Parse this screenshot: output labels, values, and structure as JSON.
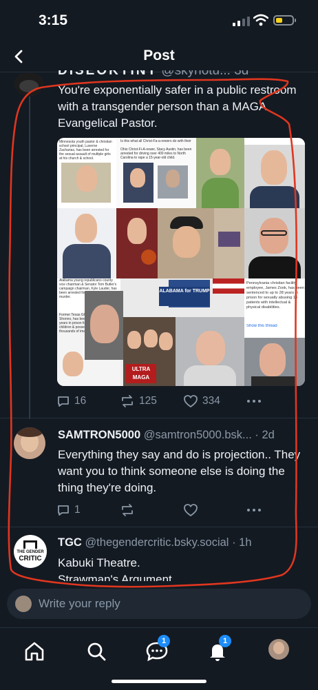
{
  "status": {
    "time": "3:15"
  },
  "header": {
    "title": "Post"
  },
  "main_post": {
    "display_name_partial": "DISEOKTINT",
    "handle_partial": "@skyhotu...",
    "time_partial": "3d",
    "text": "You're exponentially safer in a public restroom with a transgender person than a MAGA Evangelical Pastor.",
    "image": {
      "captions": [
        "Minnesota youth pastor & christian school principal, Luverne Zacharias, has been arrested for the sexual assault of multiple girls at his church & school.",
        "Is this what all Christ-Fa-a-rewers do with their Sundays?",
        "Ohio Christ-Fi-A-rewer, Stacy Austin, has been arrested for driving over 400 miles to North Carolina to rape a 15-year-old child.",
        "Alabama young republicans county vice chairman & Senator Tom Butler's campaign chairman, Kyle Lauder, has been arrested for sexual torture & murder.",
        "Former Texas GOP leader, Bo Shonno, has been sentenced to 40 years in prison for raping multiple children & possessing hundreds of thousands of images of children being sexually abused.",
        "Pennsylvania christian facility employee, James Zook, has been sentenced to up to 28 years in prison for sexually abusing 14 patients with intellectual & physical disabilities.",
        "Show this thread"
      ],
      "badges": [
        "ALABAMA for TRUMP",
        "ULTRA MAGA"
      ]
    },
    "stats": {
      "replies": "16",
      "reposts": "125",
      "likes": "334"
    }
  },
  "reply1": {
    "display_name": "SAMTRON5000",
    "handle": "@samtron5000.bsk...",
    "time": "· 2d",
    "text": "Everything they say and do is projection.. They want you to think someone else is doing the thing they're doing.",
    "stats": {
      "replies": "1"
    }
  },
  "reply2": {
    "display_name": "TGC",
    "handle": "@thegendercritic.bsky.social",
    "time": "· 1h",
    "avatar_text": [
      "THE GENDER",
      "CRITIC"
    ],
    "text_line1": "Kabuki Theatre.",
    "text_line2": "Strawman's Argument."
  },
  "composer": {
    "placeholder": "Write your reply"
  },
  "tabbar": {
    "chat_badge": "1",
    "notif_badge": "1"
  },
  "colors": {
    "background": "#141a22",
    "accent": "#1d8cf8",
    "annotation": "#e0361f",
    "muted": "#8b98a7"
  },
  "icons": [
    "back-arrow-icon",
    "reply-icon",
    "repost-icon",
    "like-icon",
    "more-icon",
    "home-icon",
    "search-icon",
    "chat-icon",
    "bell-icon"
  ]
}
